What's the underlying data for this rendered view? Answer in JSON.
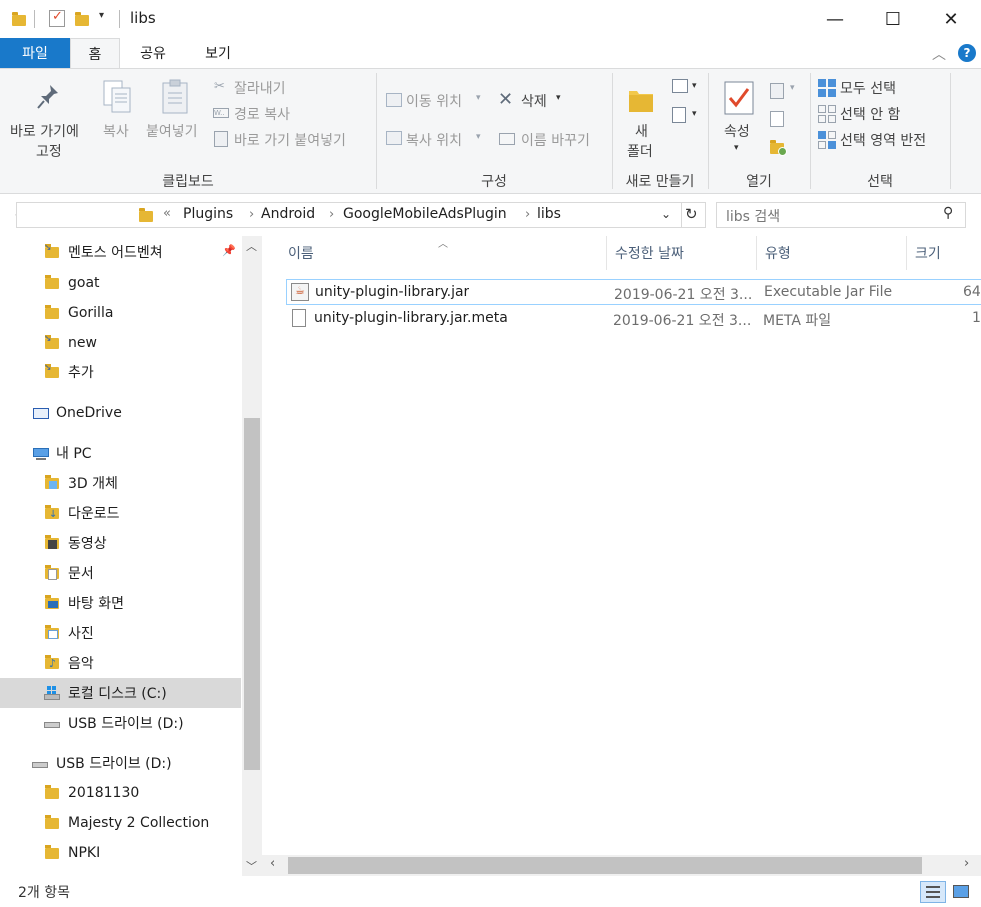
{
  "window": {
    "title": "libs",
    "minimize_glyph": "—",
    "maximize_glyph": "☐",
    "close_glyph": "✕"
  },
  "tabs": [
    {
      "label": "파일"
    },
    {
      "label": "홈"
    },
    {
      "label": "공유"
    },
    {
      "label": "보기"
    }
  ],
  "ribbon": {
    "clipboard": {
      "pin_label_1": "바로 가기에",
      "pin_label_2": "고정",
      "copy": "복사",
      "paste": "붙여넣기",
      "cut": "잘라내기",
      "copy_path": "경로 복사",
      "paste_shortcut": "바로 가기 붙여넣기",
      "group": "클립보드"
    },
    "organize": {
      "move_to": "이동 위치",
      "copy_to": "복사 위치",
      "delete": "삭제",
      "rename": "이름 바꾸기",
      "group": "구성"
    },
    "new": {
      "new_folder_1": "새",
      "new_folder_2": "폴더",
      "group": "새로 만들기"
    },
    "open": {
      "properties": "속성",
      "group": "열기"
    },
    "select": {
      "select_all": "모두 선택",
      "select_none": "선택 안 함",
      "invert": "선택 영역 반전",
      "group": "선택"
    }
  },
  "address": {
    "overflow": "«",
    "crumbs": [
      "Plugins",
      "Android",
      "GoogleMobileAdsPlugin",
      "libs"
    ],
    "search_placeholder": "libs 검색"
  },
  "nav": {
    "items": [
      {
        "label": "멘토스 어드벤쳐"
      },
      {
        "label": "goat"
      },
      {
        "label": "Gorilla"
      },
      {
        "label": "new"
      },
      {
        "label": "추가"
      },
      {
        "label": "OneDrive"
      },
      {
        "label": "내 PC"
      },
      {
        "label": "3D 개체"
      },
      {
        "label": "다운로드"
      },
      {
        "label": "동영상"
      },
      {
        "label": "문서"
      },
      {
        "label": "바탕 화면"
      },
      {
        "label": "사진"
      },
      {
        "label": "음악"
      },
      {
        "label": "로컬 디스크 (C:)"
      },
      {
        "label": "USB 드라이브 (D:)"
      },
      {
        "label": "USB 드라이브 (D:)"
      },
      {
        "label": "20181130"
      },
      {
        "label": "Majesty 2 Collection"
      },
      {
        "label": "NPKI"
      }
    ]
  },
  "columns": {
    "name": "이름",
    "date": "수정한 날짜",
    "type": "유형",
    "size": "크기"
  },
  "files": [
    {
      "name": "unity-plugin-library.jar",
      "date": "2019-06-21 오전 3...",
      "type": "Executable Jar File",
      "size": "64"
    },
    {
      "name": "unity-plugin-library.jar.meta",
      "date": "2019-06-21 오전 3...",
      "type": "META 파일",
      "size": "1"
    }
  ],
  "status": {
    "count": "2개 항목"
  },
  "colors": {
    "file_tab": "#1979ca",
    "selection": "#d9d9d9",
    "hover_border": "#99d1ff"
  }
}
